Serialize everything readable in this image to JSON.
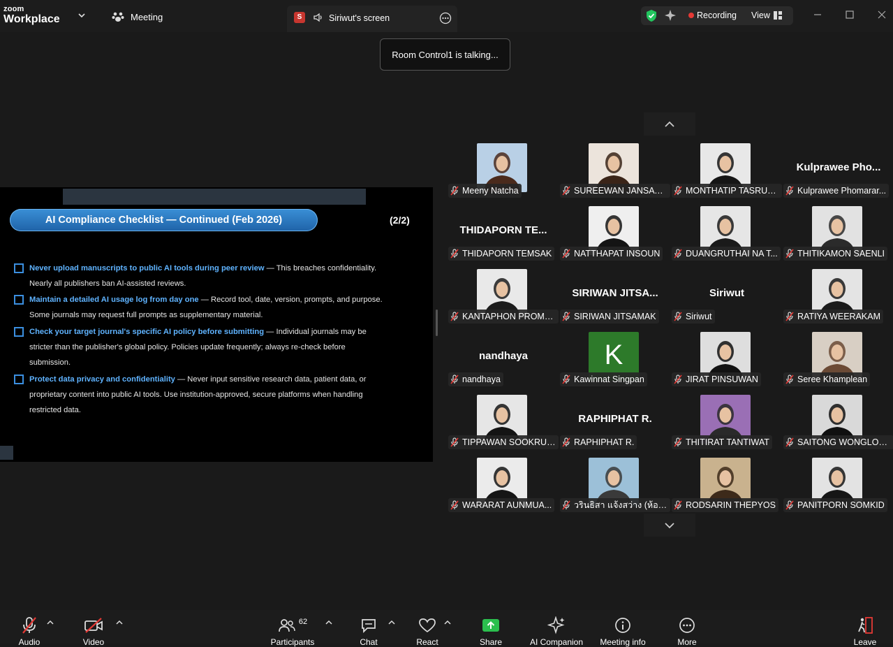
{
  "app": {
    "brand_top": "zoom",
    "brand_bottom": "Workplace"
  },
  "tabs": {
    "meeting": "Meeting",
    "screen": "Siriwut's screen",
    "screen_avatar": "S"
  },
  "recording": {
    "label": "Recording",
    "view": "View"
  },
  "toast": "Room Control1 is talking...",
  "slide": {
    "title": "AI Compliance Checklist — Continued (Feb 2026)",
    "page": "(2/2)",
    "items": [
      {
        "bold": "Never upload manuscripts to public AI tools during peer review",
        "line1": " — This breaches confidentiality.",
        "line2": "Nearly all publishers ban AI-assisted reviews.",
        "line3": ""
      },
      {
        "bold": "Maintain a detailed AI usage log from day one",
        "line1": " — Record tool, date, version, prompts, and purpose.",
        "line2": "Some journals may request full prompts as supplementary material.",
        "line3": ""
      },
      {
        "bold": "Check your target journal's specific AI policy before submitting",
        "line1": " — Individual journals may be",
        "line2": "stricter than the publisher's global policy. Policies update frequently; always re-check before",
        "line3": "submission."
      },
      {
        "bold": "Protect data privacy and confidentiality",
        "line1": " — Never input sensitive research data, patient data, or",
        "line2": "proprietary content into public AI tools. Use institution-approved, secure platforms when handling",
        "line3": "restricted data."
      }
    ]
  },
  "participants": [
    {
      "name": "Meeny Natcha",
      "big": "",
      "kind": "photo",
      "bg": "#b9d0e6",
      "fg": "#4a2a1c"
    },
    {
      "name": "SUREEWAN JANSAW...",
      "big": "",
      "kind": "photo",
      "bg": "#ece4dc",
      "fg": "#3a2418"
    },
    {
      "name": "MONTHATIP TASRUK...",
      "big": "",
      "kind": "photo",
      "bg": "#e8e8e8",
      "fg": "#151515"
    },
    {
      "name": "Kulprawee Phomarar...",
      "big": "Kulprawee  Pho...",
      "kind": "name"
    },
    {
      "name": "THIDAPORN TEMSAK",
      "big": "THIDAPORN  TE...",
      "kind": "name"
    },
    {
      "name": "NATTHAPAT INSOUN",
      "big": "",
      "kind": "photo",
      "bg": "#efefef",
      "fg": "#141414"
    },
    {
      "name": "DUANGRUTHAI NA T...",
      "big": "",
      "kind": "photo",
      "bg": "#e6e6e6",
      "fg": "#1a1a1a"
    },
    {
      "name": "THITIKAMON SAENLI",
      "big": "",
      "kind": "photo",
      "bg": "#e2e2e2",
      "fg": "#2b2b2b"
    },
    {
      "name": "KANTAPHON PROMK...",
      "big": "",
      "kind": "photo",
      "bg": "#e9e9e9",
      "fg": "#1c1c1c"
    },
    {
      "name": "SIRIWAN JITSAMAK",
      "big": "SIRIWAN  JITSA...",
      "kind": "name"
    },
    {
      "name": "Siriwut",
      "big": "Siriwut",
      "kind": "name"
    },
    {
      "name": "RATIYA WEERAKAM",
      "big": "",
      "kind": "photo",
      "bg": "#e4e4e4",
      "fg": "#1b1b1b"
    },
    {
      "name": "nandhaya",
      "big": "nandhaya",
      "kind": "name"
    },
    {
      "name": "Kawinnat Singpan",
      "big": "K",
      "kind": "letter"
    },
    {
      "name": "JIRAT PINSUWAN",
      "big": "",
      "kind": "photo",
      "bg": "#dedede",
      "fg": "#121212"
    },
    {
      "name": "Seree Khamplean",
      "big": "",
      "kind": "photo",
      "bg": "#d8cfc4",
      "fg": "#6b4a35"
    },
    {
      "name": "TIPPAWAN SOOKRUAY",
      "big": "",
      "kind": "photo",
      "bg": "#e6e6e6",
      "fg": "#141414"
    },
    {
      "name": "RAPHIPHAT R.",
      "big": "RAPHIPHAT R.",
      "kind": "name"
    },
    {
      "name": "THITIRAT TANTIWAT",
      "big": "",
      "kind": "photo",
      "bg": "#9a6fb5",
      "fg": "#2a2a2a"
    },
    {
      "name": "SAITONG WONGLOD...",
      "big": "",
      "kind": "photo",
      "bg": "#d9d9d9",
      "fg": "#101010"
    },
    {
      "name": "WARARAT AUNMUA...",
      "big": "",
      "kind": "photo",
      "bg": "#ebebeb",
      "fg": "#151515"
    },
    {
      "name": "วรินธิสา แจ้งสว่าง (ห้องส...",
      "big": "",
      "kind": "photo",
      "bg": "#9cc0d8",
      "fg": "#3a3a3a"
    },
    {
      "name": "RODSARIN THEPYOS",
      "big": "",
      "kind": "photo",
      "bg": "#c9b28e",
      "fg": "#3d2a1a"
    },
    {
      "name": "PANITPORN SOMKID",
      "big": "",
      "kind": "photo",
      "bg": "#e3e3e3",
      "fg": "#161616"
    }
  ],
  "toolbar": {
    "audio": "Audio",
    "video": "Video",
    "participants": "Participants",
    "participants_count": "62",
    "chat": "Chat",
    "react": "React",
    "share": "Share",
    "ai": "AI Companion",
    "info": "Meeting info",
    "more": "More",
    "leave": "Leave"
  },
  "colors": {
    "share_green": "#2bbf4e",
    "recording_red": "#e53935",
    "slide_accent": "#5fb3ff",
    "shield_green": "#22c55e"
  }
}
